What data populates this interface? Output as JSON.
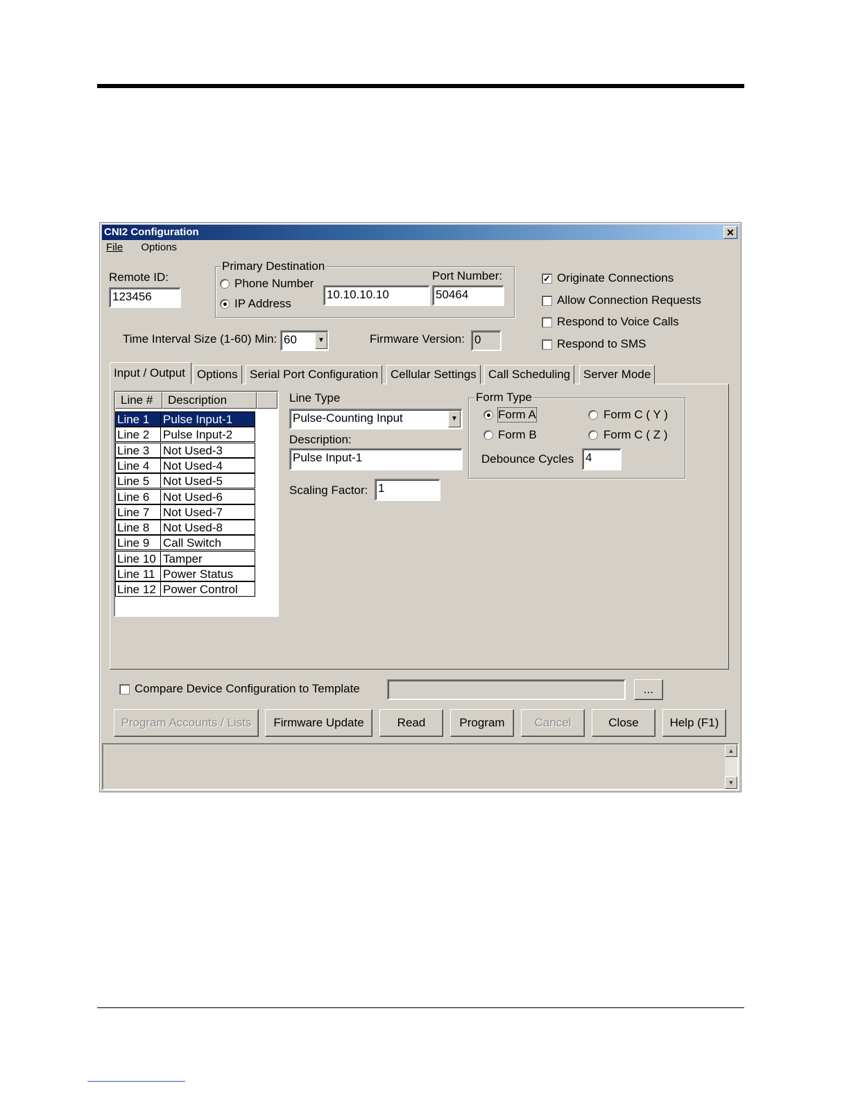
{
  "window": {
    "title": "CNI2 Configuration",
    "close_glyph": "✕"
  },
  "menu": {
    "file": "File",
    "options": "Options"
  },
  "remote_id": {
    "label": "Remote ID:",
    "value": "123456"
  },
  "primary_destination": {
    "legend": "Primary Destination",
    "phone_label": "Phone Number",
    "ip_label": "IP Address",
    "address_value": "10.10.10.10",
    "port_label": "Port Number:",
    "port_value": "50464",
    "selected": "IP Address"
  },
  "connection_options": [
    {
      "label": "Originate Connections",
      "checked": true
    },
    {
      "label": "Allow Connection Requests",
      "checked": false
    },
    {
      "label": "Respond to Voice Calls",
      "checked": false
    },
    {
      "label": "Respond to SMS",
      "checked": false
    }
  ],
  "time_interval": {
    "label": "Time Interval Size (1-60) Min:",
    "value": "60"
  },
  "firmware_version": {
    "label": "Firmware Version:",
    "value": "0"
  },
  "tabs": [
    "Input / Output",
    "Options",
    "Serial Port Configuration",
    "Cellular Settings",
    "Call Scheduling",
    "Server Mode"
  ],
  "active_tab": "Input / Output",
  "lines_table": {
    "headers": [
      "Line #",
      "Description"
    ],
    "rows": [
      [
        "Line 1",
        "Pulse Input-1"
      ],
      [
        "Line 2",
        "Pulse Input-2"
      ],
      [
        "Line 3",
        "Not Used-3"
      ],
      [
        "Line 4",
        "Not Used-4"
      ],
      [
        "Line 5",
        "Not Used-5"
      ],
      [
        "Line 6",
        "Not Used-6"
      ],
      [
        "Line 7",
        "Not Used-7"
      ],
      [
        "Line 8",
        "Not Used-8"
      ],
      [
        "Line 9",
        "Call Switch"
      ],
      [
        "Line 10",
        "Tamper"
      ],
      [
        "Line 11",
        "Power Status"
      ],
      [
        "Line 12",
        "Power Control"
      ]
    ],
    "selected_row": "Line 1"
  },
  "line_type": {
    "label": "Line Type",
    "value": "Pulse-Counting Input"
  },
  "description": {
    "label": "Description:",
    "value": "Pulse Input-1"
  },
  "scaling_factor": {
    "label": "Scaling Factor:",
    "value": "1"
  },
  "form_type": {
    "legend": "Form Type",
    "options": [
      "Form A",
      "Form C ( Y )",
      "Form B",
      "Form C ( Z )"
    ],
    "selected": "Form A",
    "debounce_label": "Debounce Cycles",
    "debounce_value": "4"
  },
  "compare": {
    "label": "Compare Device Configuration to Template",
    "checked": false,
    "template_value": "",
    "browse_label": "..."
  },
  "buttons": {
    "program_accounts": "Program Accounts / Lists",
    "firmware_update": "Firmware Update",
    "read": "Read",
    "program": "Program",
    "cancel": "Cancel",
    "close": "Close",
    "help": "Help (F1)"
  },
  "colors": {
    "titlebar_start": "#0a246a",
    "titlebar_end": "#a6caf0",
    "face": "#d4d0c8",
    "selection": "#0a246a"
  },
  "icons": {
    "dropdown": "chevron-down-icon",
    "scroll_up": "arrow-up-icon",
    "scroll_down": "arrow-down-icon"
  }
}
